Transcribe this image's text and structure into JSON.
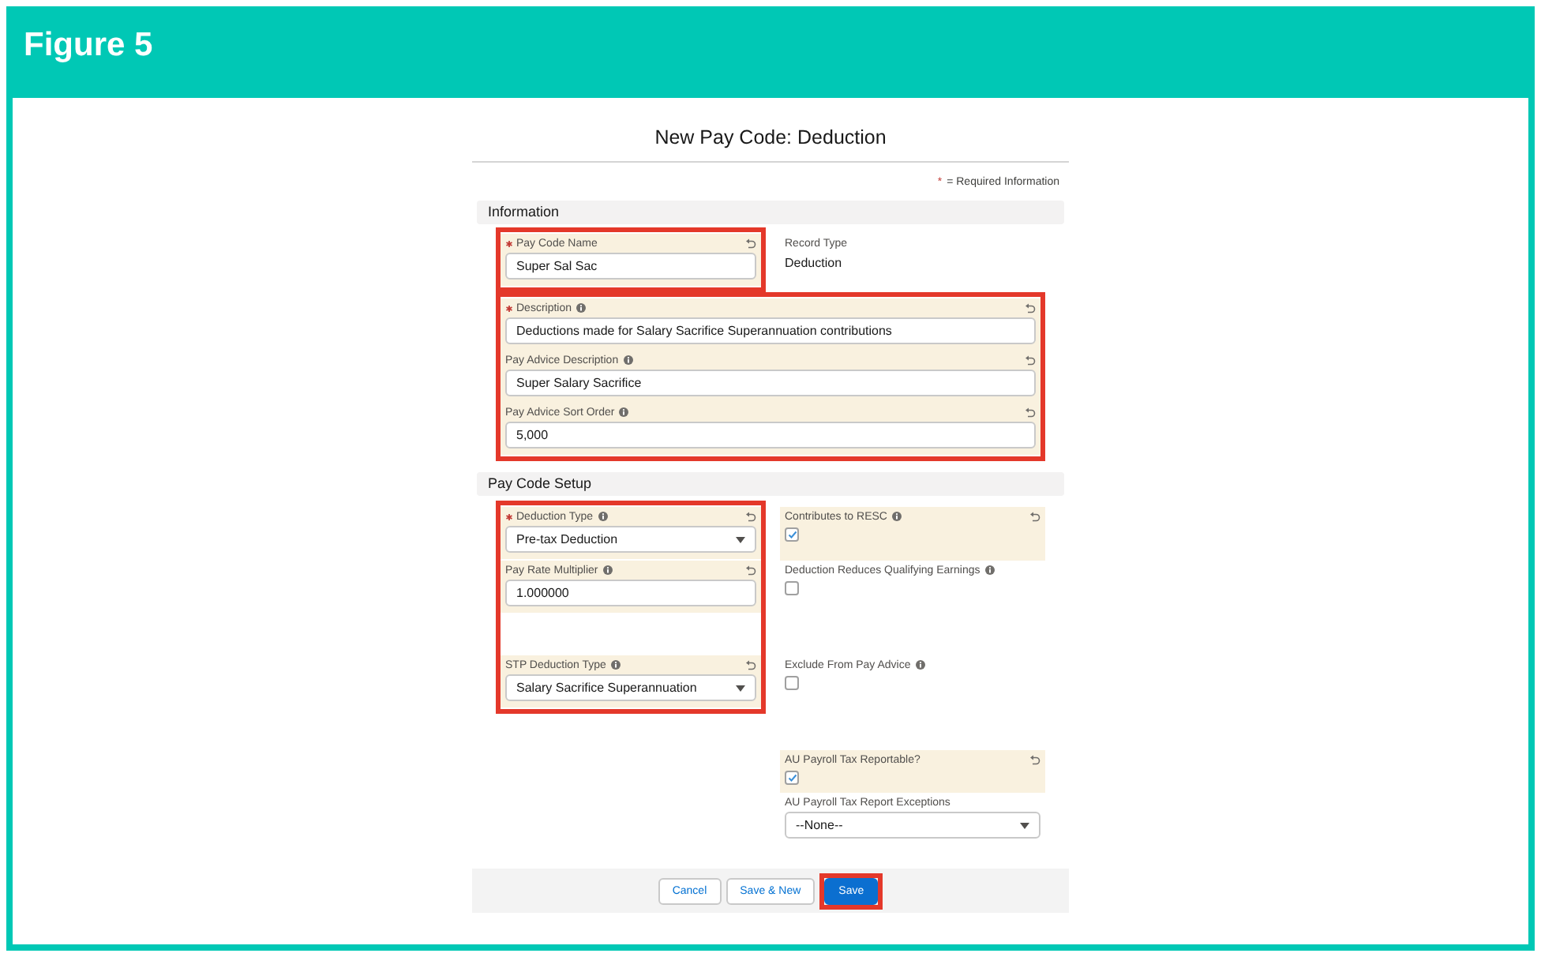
{
  "figure": {
    "title": "Figure 5"
  },
  "dialog": {
    "title": "New Pay Code: Deduction",
    "required_note": {
      "marker": "*",
      "text": "= Required Information"
    },
    "sections": [
      {
        "title": "Information",
        "kind": "rows",
        "rows": [
          [
            {
              "outlined": true,
              "fields": [
                {
                  "kind": "text",
                  "label": "Pay Code Name",
                  "required": true,
                  "info": false,
                  "edited": true,
                  "value": "Super Sal Sac"
                }
              ]
            },
            {
              "fields": [
                {
                  "kind": "readonly",
                  "label": "Record Type",
                  "required": false,
                  "info": false,
                  "edited": false,
                  "value": "Deduction"
                }
              ]
            }
          ],
          [
            {
              "outlined": true,
              "fields": [
                {
                  "kind": "text",
                  "label": "Description",
                  "required": true,
                  "info": true,
                  "edited": true,
                  "value": "Deductions made for Salary Sacrifice Superannuation contributions"
                },
                {
                  "kind": "text",
                  "label": "Pay Advice Description",
                  "required": false,
                  "info": true,
                  "edited": true,
                  "value": "Super Salary Sacrifice"
                },
                {
                  "kind": "text",
                  "label": "Pay Advice Sort Order",
                  "required": false,
                  "info": true,
                  "edited": true,
                  "value": "5,000"
                }
              ]
            }
          ]
        ]
      },
      {
        "title": "Pay Code Setup",
        "kind": "aligned_columns",
        "rows": [
          [
            {
              "outlined": true,
              "fields": [
                {
                  "kind": "select",
                  "label": "Deduction Type",
                  "required": true,
                  "info": true,
                  "edited": true,
                  "value": "Pre-tax Deduction"
                },
                {
                  "kind": "text",
                  "label": "Pay Rate Multiplier",
                  "required": false,
                  "info": true,
                  "edited": true,
                  "value": "1.000000"
                },
                {
                  "kind": "select",
                  "label": "STP Deduction Type",
                  "required": false,
                  "info": true,
                  "edited": true,
                  "value": "Salary Sacrifice Superannuation"
                }
              ]
            },
            {
              "fields": [
                {
                  "kind": "checkbox",
                  "label": "Contributes to RESC",
                  "required": false,
                  "info": true,
                  "edited": true,
                  "checked": true
                },
                {
                  "kind": "checkbox",
                  "label": "Deduction Reduces Qualifying Earnings",
                  "required": false,
                  "info": true,
                  "edited": false,
                  "checked": false
                },
                {
                  "kind": "checkbox",
                  "label": "Exclude From Pay Advice",
                  "required": false,
                  "info": true,
                  "edited": false,
                  "checked": false
                },
                {
                  "kind": "checkbox",
                  "label": "AU Payroll Tax Reportable?",
                  "required": false,
                  "info": false,
                  "edited": true,
                  "checked": true
                },
                {
                  "kind": "select",
                  "label": "AU Payroll Tax Report Exceptions",
                  "required": false,
                  "info": false,
                  "edited": false,
                  "value": "--None--"
                }
              ]
            }
          ]
        ]
      }
    ],
    "buttons": [
      {
        "label": "Cancel",
        "kind": "neutral"
      },
      {
        "label": "Save & New",
        "kind": "neutral"
      },
      {
        "label": "Save",
        "kind": "brand",
        "outlined": true
      }
    ]
  }
}
